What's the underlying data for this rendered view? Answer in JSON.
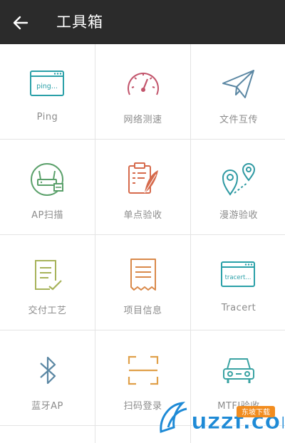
{
  "app_bar": {
    "title": "工具箱"
  },
  "tools": [
    {
      "label": "Ping",
      "icon": "ping-window-icon",
      "color": "#2aa0a8"
    },
    {
      "label": "网络测速",
      "icon": "speedometer-icon",
      "color": "#c2546b"
    },
    {
      "label": "文件互传",
      "icon": "paper-plane-icon",
      "color": "#5b87a3"
    },
    {
      "label": "AP扫描",
      "icon": "router-scan-icon",
      "color": "#5aa06a"
    },
    {
      "label": "单点验收",
      "icon": "clipboard-feather-icon",
      "color": "#d66a4c"
    },
    {
      "label": "漫游验收",
      "icon": "location-pins-icon",
      "color": "#2f9aa3"
    },
    {
      "label": "交付工艺",
      "icon": "checklist-doc-icon",
      "color": "#a7b35a"
    },
    {
      "label": "项目信息",
      "icon": "receipt-doc-icon",
      "color": "#d9894a"
    },
    {
      "label": "Tracert",
      "icon": "tracert-window-icon",
      "color": "#2aa0a8"
    },
    {
      "label": "蓝牙AP",
      "icon": "bluetooth-icon",
      "color": "#5b87a3"
    },
    {
      "label": "扫码登录",
      "icon": "scan-frame-icon",
      "color": "#e0a04a"
    },
    {
      "label": "MTFI验收",
      "icon": "car-icon",
      "color": "#3aa3a3"
    }
  ],
  "icon_text": {
    "ping": "ping...",
    "tracert": "tracert..."
  },
  "watermark": {
    "logo_text": "uzzf.com",
    "badge": "东坡下载"
  }
}
